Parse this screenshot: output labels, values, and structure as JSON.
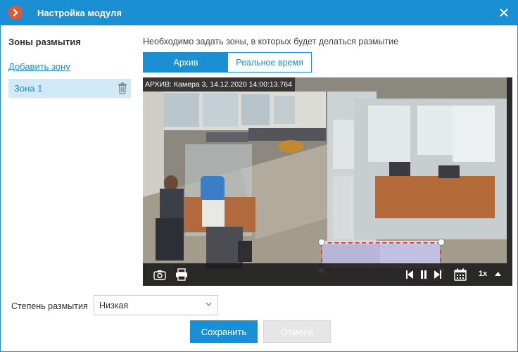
{
  "window": {
    "title": "Настройка модуля",
    "accent_color": "#1a8fd3",
    "logo_color": "#e8542e",
    "logo_icon": "chevron-right-icon",
    "close_icon": "close-icon"
  },
  "sidebar": {
    "title": "Зоны размытия",
    "add_zone_label": "Добавить зону",
    "zones": [
      {
        "label": "Зона 1",
        "selected": true,
        "action_icon": "trash-icon"
      }
    ]
  },
  "main": {
    "instruction": "Необходимо задать зоны, в которых будет делаться размытие",
    "tabs": [
      {
        "label": "Архив",
        "active": true
      },
      {
        "label": "Реальное время",
        "active": false
      }
    ],
    "video": {
      "caption": "АРХИВ: Камера 3, 14.12.2020 14:00:13.764",
      "controls": [
        "camera-icon",
        "printer-icon",
        "step-back-icon",
        "pause-icon",
        "step-forward-icon",
        "calendar-icon",
        "chevron-up-icon"
      ],
      "speed": "1x",
      "blur_zone_color": "#e8412c"
    }
  },
  "footer": {
    "blur_level_label": "Степень размытия",
    "blur_level_value": "Низкая",
    "save_label": "Сохранить",
    "cancel_label": "Отмена",
    "cancel_enabled": false
  }
}
